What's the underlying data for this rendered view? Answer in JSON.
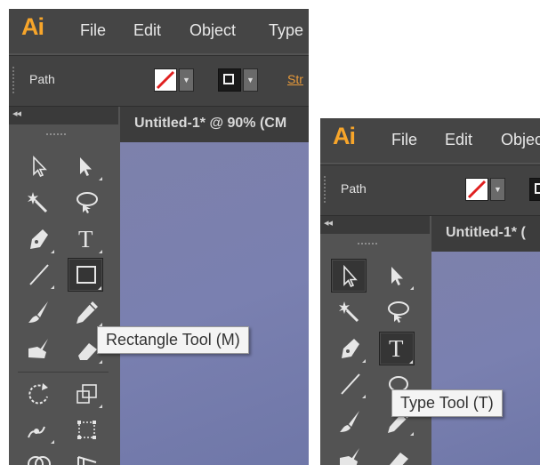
{
  "left": {
    "logo": "Ai",
    "menu": [
      "File",
      "Edit",
      "Object",
      "Type"
    ],
    "control_bar": {
      "label": "Path",
      "stroke_link": "Str"
    },
    "document_tab": "Untitled-1* @ 90% (CM",
    "tooltip": "Rectangle Tool (M)"
  },
  "right": {
    "logo": "Ai",
    "menu": [
      "File",
      "Edit",
      "Objec"
    ],
    "control_bar": {
      "label": "Path"
    },
    "document_tab": "Untitled-1* (",
    "tooltip": "Type Tool (T)"
  },
  "glyphs": {
    "type_tool": "T"
  },
  "colors": {
    "logo": "#f7a52a",
    "ui_dark": "#454545",
    "ui_mid": "#535353",
    "canvas": "#7a80b0",
    "stroke_link": "#e89a3a",
    "none_swatch_slash": "#e02020"
  }
}
